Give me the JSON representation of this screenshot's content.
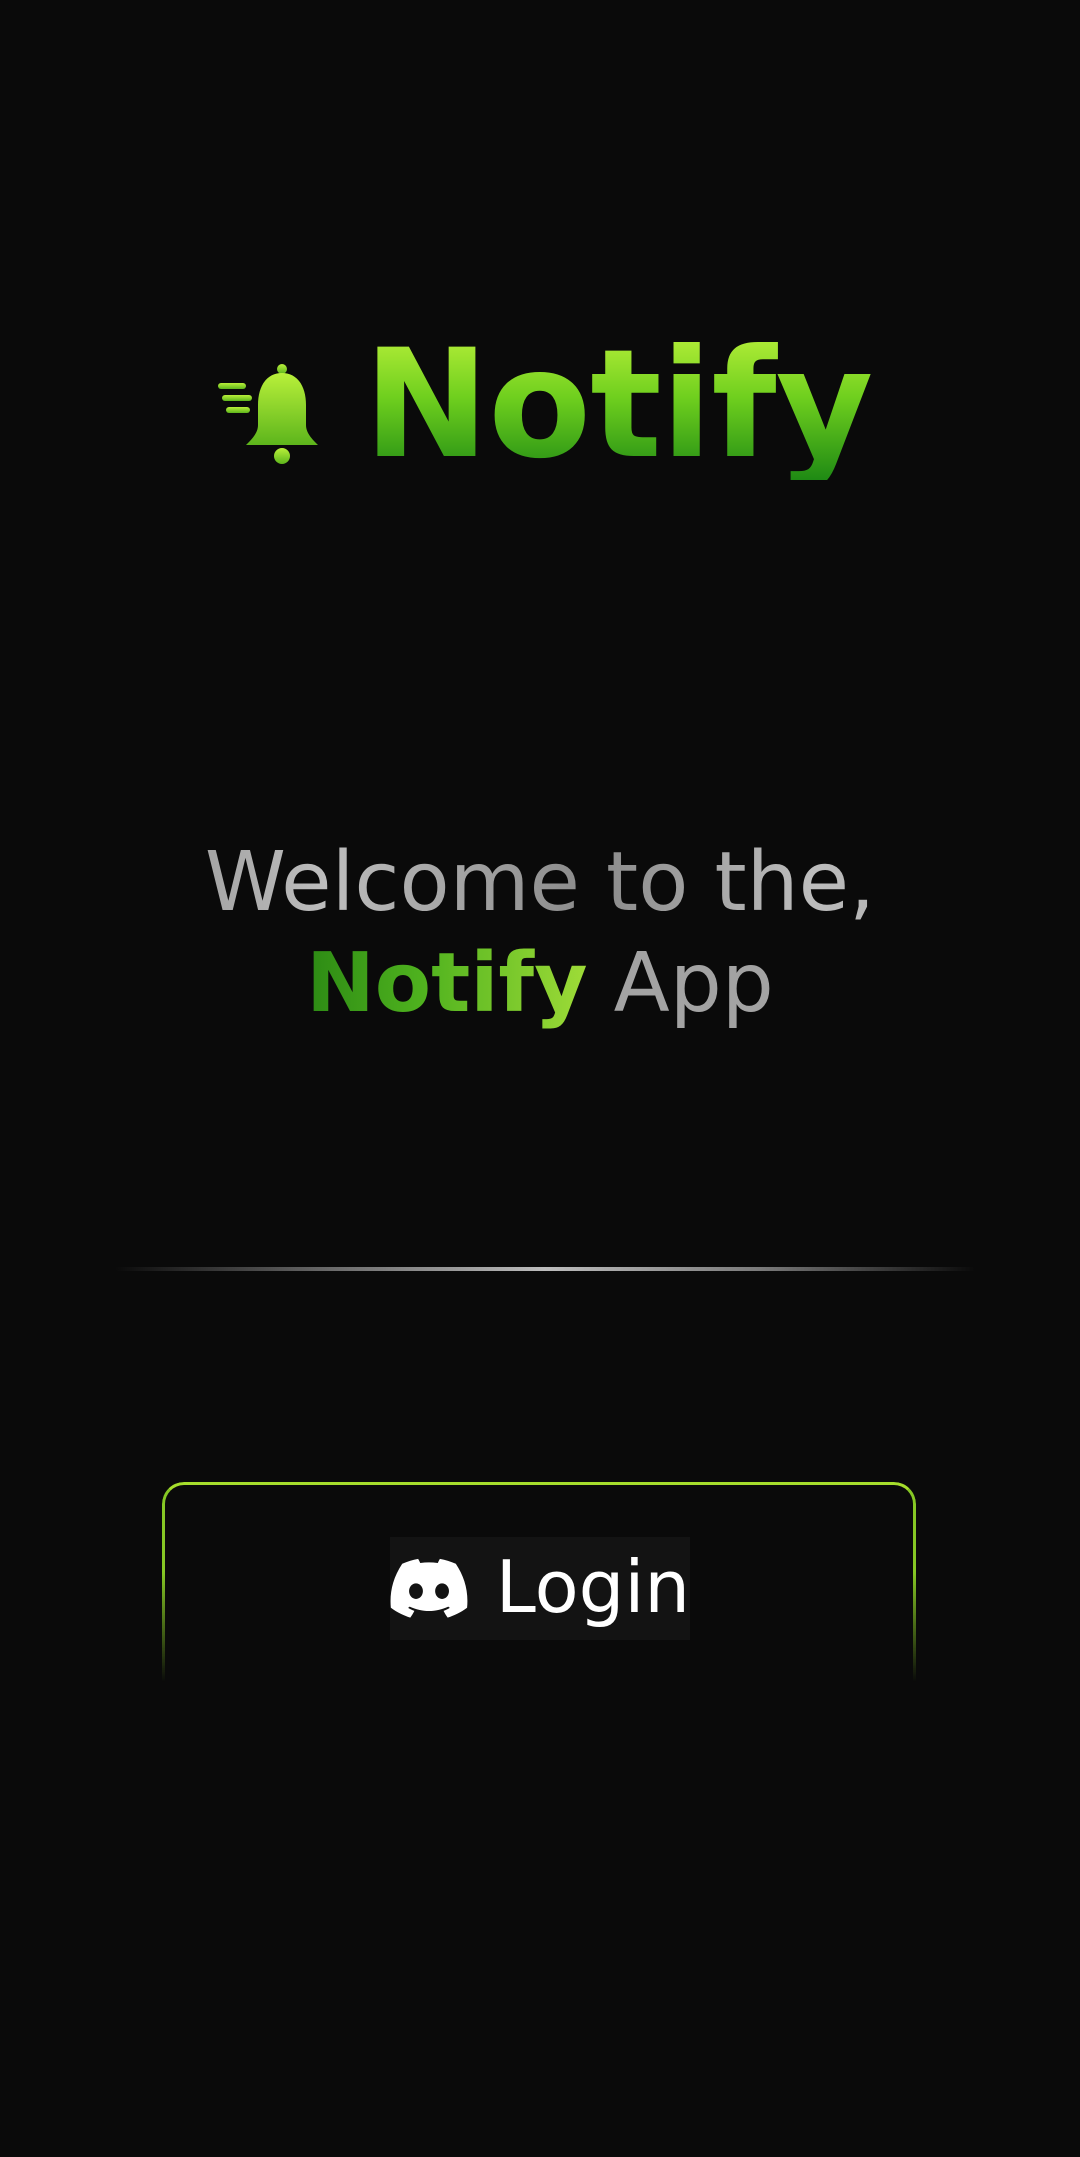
{
  "app": {
    "brand_name": "Notify",
    "logo_icon": "bell-icon"
  },
  "welcome": {
    "line1": "Welcome to the,",
    "line2_highlight": "Notify",
    "line2_rest": "App"
  },
  "login": {
    "label": "Login",
    "icon": "discord-icon"
  },
  "colors": {
    "background": "#0a0a0a",
    "brand_light": "#b9f03a",
    "brand_dark": "#1f8a14",
    "card_border": "#a6de2c",
    "button_bg": "#131313",
    "text_gray": "#a3a3a3"
  }
}
